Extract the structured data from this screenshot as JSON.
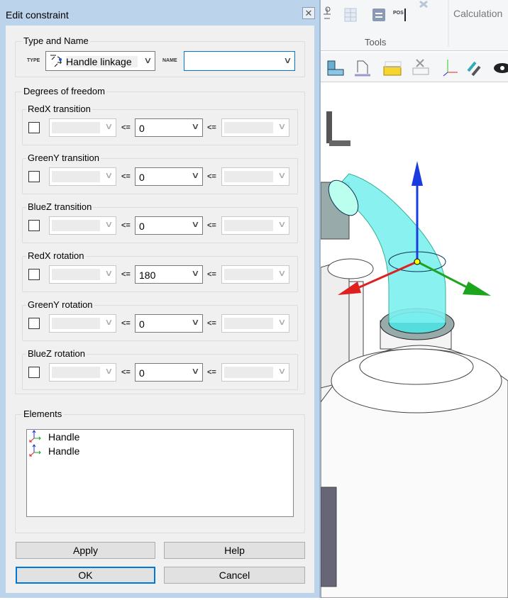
{
  "dialog": {
    "title": "Edit constraint",
    "close_icon": "close-icon"
  },
  "type_and_name": {
    "legend": "Type and Name",
    "type_label": "TYPE",
    "type_value": "Handle linkage",
    "name_label": "NAME",
    "name_value": ""
  },
  "dof": {
    "legend": "Degrees of freedom",
    "op": "<=",
    "rows": [
      {
        "label": "RedX transition",
        "value": "0",
        "checked": false
      },
      {
        "label": "GreenY transition",
        "value": "0",
        "checked": false
      },
      {
        "label": "BlueZ transition",
        "value": "0",
        "checked": false
      },
      {
        "label": "RedX rotation",
        "value": "180",
        "checked": false
      },
      {
        "label": "GreenY rotation",
        "value": "0",
        "checked": false
      },
      {
        "label": "BlueZ rotation",
        "value": "0",
        "checked": false
      }
    ]
  },
  "elements": {
    "legend": "Elements",
    "items": [
      "Handle",
      "Handle"
    ]
  },
  "buttons": {
    "apply": "Apply",
    "help": "Help",
    "ok": "OK",
    "cancel": "Cancel"
  },
  "ribbon": {
    "tools_label": "Tools",
    "calculation_label": "Calculation",
    "pos_label": "POS"
  }
}
